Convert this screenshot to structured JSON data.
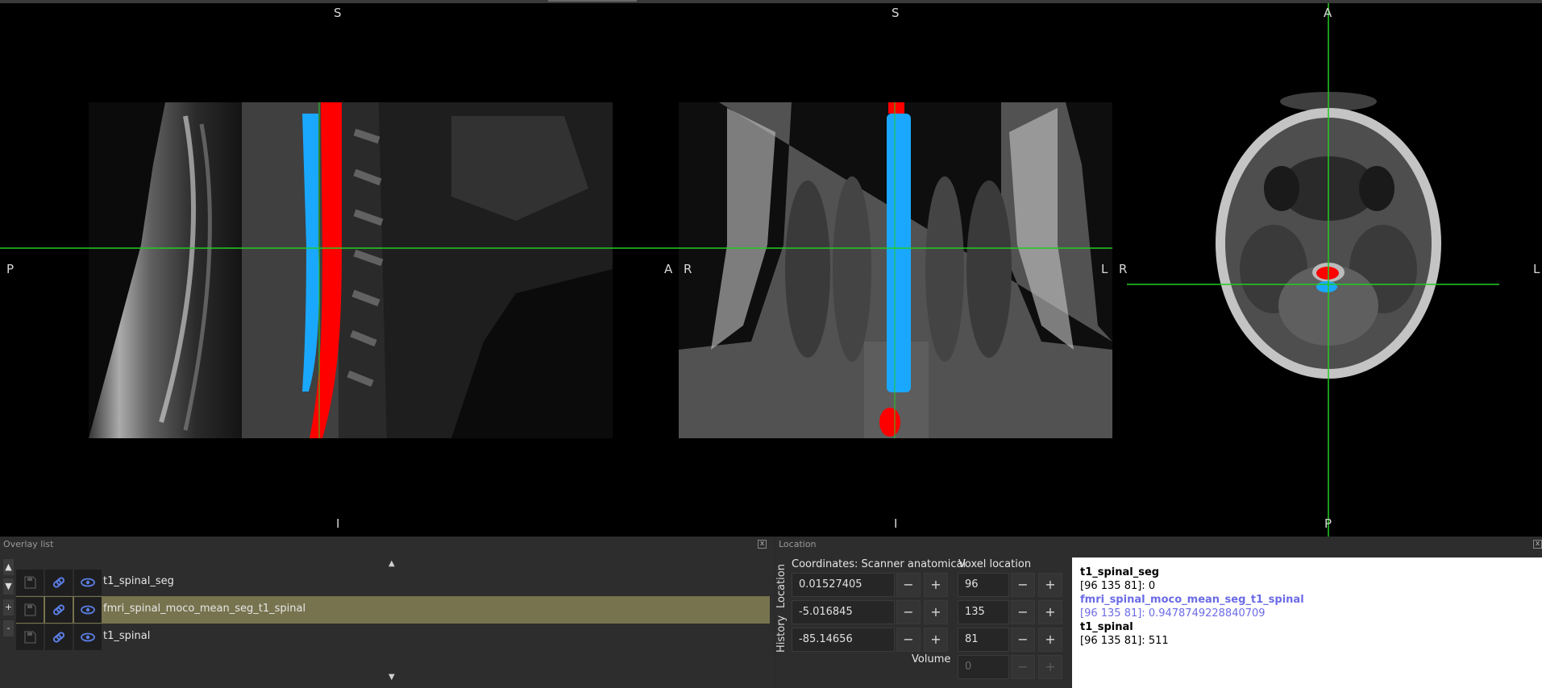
{
  "viewer": {
    "sagittal": {
      "top": "S",
      "bottom": "I",
      "left": "P",
      "right": "A"
    },
    "coronal": {
      "top": "S",
      "bottom": "I",
      "left": "R",
      "right": "L"
    },
    "axial": {
      "top": "A",
      "bottom": "P",
      "left": "R",
      "right": "L"
    },
    "crosshair_color": "#22cc22",
    "seg_colors": {
      "cord": "#1aa8ff",
      "csf": "#ff0000"
    }
  },
  "overlay_list": {
    "title": "Overlay list",
    "close": "x",
    "side_buttons": [
      "▲",
      "▼",
      "+",
      "-"
    ],
    "scroll_up": "▲",
    "scroll_down": "▼",
    "items": [
      {
        "label": "t1_spinal_seg",
        "selected": false
      },
      {
        "label": "fmri_spinal_moco_mean_seg_t1_spinal",
        "selected": true
      },
      {
        "label": "t1_spinal",
        "selected": false
      }
    ]
  },
  "location": {
    "title": "Location",
    "close": "x",
    "tabs": [
      "Location",
      "History"
    ],
    "coords_header": "Coordinates: Scanner anatomical",
    "voxel_header": "Voxel location",
    "coords": [
      "0.01527405",
      "-5.016845",
      "-85.14656"
    ],
    "voxels": [
      "96",
      "135",
      "81"
    ],
    "minus": "−",
    "plus": "+",
    "volume_label": "Volume",
    "volume_value": "0"
  },
  "info": [
    {
      "name": "t1_spinal_seg",
      "value": "[96 135 81]: 0",
      "highlight": false
    },
    {
      "name": "fmri_spinal_moco_mean_seg_t1_spinal",
      "value": "[96 135 81]: 0.9478749228840709",
      "highlight": true
    },
    {
      "name": "t1_spinal",
      "value": "[96 135 81]: 511",
      "highlight": false
    }
  ]
}
